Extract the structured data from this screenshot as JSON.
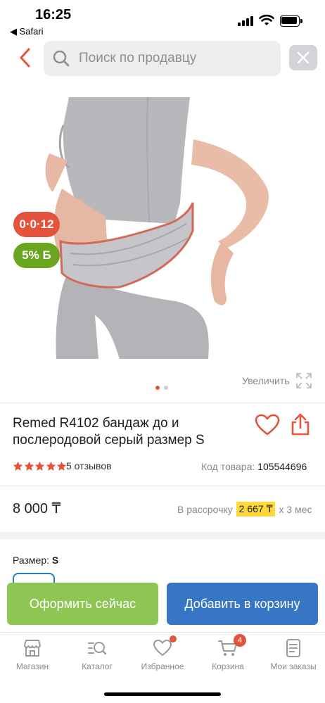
{
  "status_bar": {
    "time": "16:25",
    "back_app": "◀ Safari"
  },
  "search": {
    "placeholder": "Поиск по продавцу",
    "value": ""
  },
  "product": {
    "badge_timer": "0·0·12",
    "badge_bonus": "5% Б",
    "zoom_label": "Увеличить",
    "slides_total": 2,
    "slide_active": 1,
    "title": "Remed R4102 бандаж до и послеродовой серый размер S",
    "rating": 5,
    "reviews": "5 отзывов",
    "sku_label": "Код товара:",
    "sku_value": "105544696",
    "price": "8 000 ₸",
    "installment_prefix": "В рассрочку",
    "installment_amount": "2 667 ₸",
    "installment_suffix": "х 3 мес",
    "size_label": "Размер:",
    "size_value": "S"
  },
  "actions": {
    "buy_now": "Оформить сейчас",
    "add_to_cart": "Добавить в корзину"
  },
  "tabbar": {
    "items": [
      {
        "label": "Магазин",
        "icon": "store-icon"
      },
      {
        "label": "Каталог",
        "icon": "catalog-search-icon"
      },
      {
        "label": "Избранное",
        "icon": "heart-icon"
      },
      {
        "label": "Корзина",
        "icon": "cart-icon",
        "badge": "4"
      },
      {
        "label": "Мои заказы",
        "icon": "orders-icon"
      }
    ]
  },
  "colors": {
    "accent_red": "#e5533d",
    "bonus_green": "#6aa51f",
    "buy_green": "#8ec653",
    "cart_blue": "#3776c4",
    "installment_yellow": "#ffd83a"
  }
}
